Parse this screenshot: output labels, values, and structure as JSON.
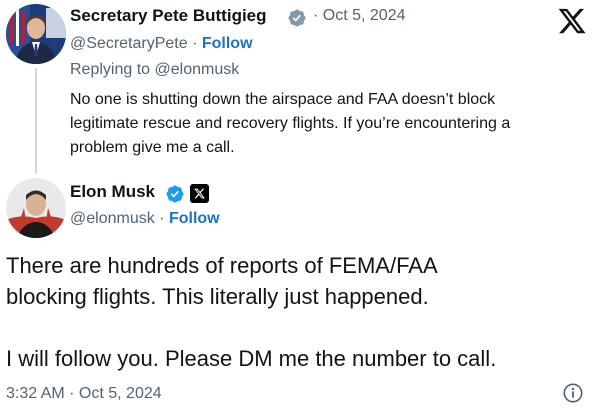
{
  "colors": {
    "text": "#0f1419",
    "secondary": "#536471",
    "link": "#1d72c8",
    "verified": "#1d9bf0",
    "thread_line": "#cfd9de"
  },
  "brand": {
    "icon": "x-logo-icon"
  },
  "tweet1": {
    "author_name": "Secretary Pete Buttigieg",
    "verified_icon": "government-verified-icon",
    "separator": "·",
    "date": "Oct 5, 2024",
    "handle": "@SecretaryPete",
    "follow_label": "Follow",
    "replying_to": "Replying to @elonmusk",
    "text_lines": [
      "No one is shutting down the airspace and FAA doesn’t block",
      "legitimate rescue and recovery flights. If you’re encountering a",
      "problem give me a call."
    ]
  },
  "tweet2": {
    "author_name": "Elon Musk",
    "verified_icon": "verified-badge-icon",
    "affiliate_icon": "x-affiliate-badge-icon",
    "handle": "@elonmusk",
    "separator": "·",
    "follow_label": "Follow",
    "text_lines": [
      "There are hundreds of reports of FEMA/FAA",
      "blocking flights. This literally just happened.",
      "I will follow you. Please DM me the number to call."
    ],
    "timestamp": "3:32 AM · Oct 5, 2024",
    "info_icon": "info-icon"
  }
}
